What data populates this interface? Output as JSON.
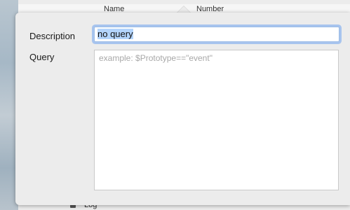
{
  "background": {
    "header_col_1": "Name",
    "header_col_2": "Number",
    "bottom_text": "Log"
  },
  "popover": {
    "description_label": "Description",
    "description_value": "no query",
    "query_label": "Query",
    "query_placeholder": "example: $Prototype==\"event\""
  },
  "colors": {
    "focus_ring": "#a7c4ee",
    "selection": "#b3d4fc",
    "popover_bg": "#ececec"
  }
}
